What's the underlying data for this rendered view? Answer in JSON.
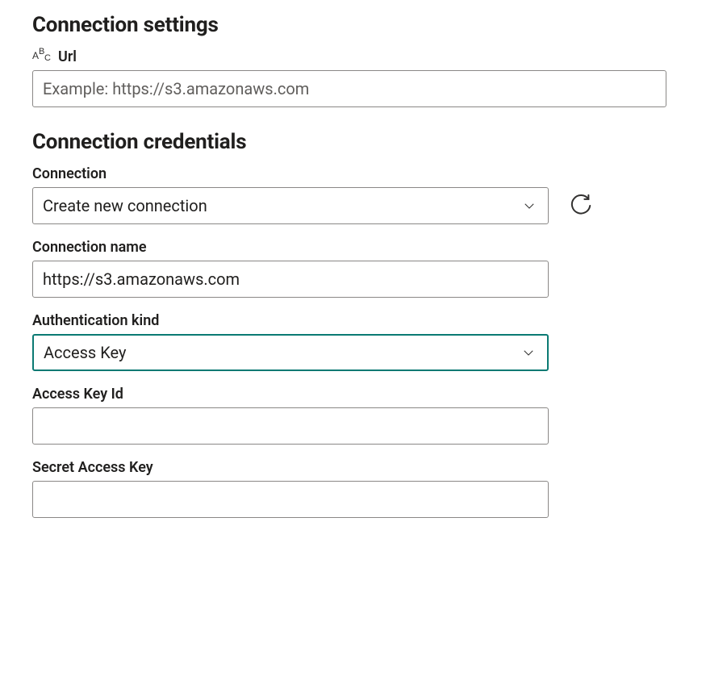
{
  "settings": {
    "title": "Connection settings",
    "url_label": "Url",
    "url_placeholder": "Example: https://s3.amazonaws.com",
    "url_value": ""
  },
  "credentials": {
    "title": "Connection credentials",
    "connection_label": "Connection",
    "connection_value": "Create new connection",
    "connection_name_label": "Connection name",
    "connection_name_value": "https://s3.amazonaws.com",
    "auth_kind_label": "Authentication kind",
    "auth_kind_value": "Access Key",
    "access_key_id_label": "Access Key Id",
    "access_key_id_value": "",
    "secret_access_key_label": "Secret Access Key",
    "secret_access_key_value": ""
  }
}
